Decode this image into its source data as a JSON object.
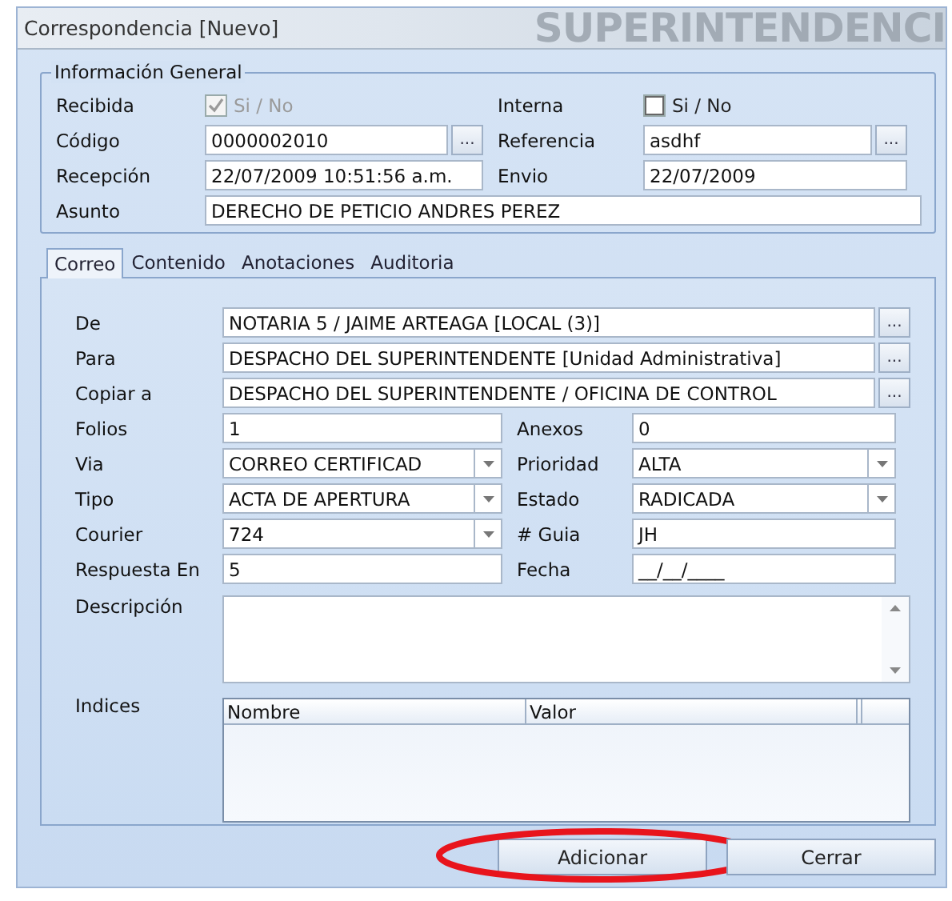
{
  "window": {
    "title": "Correspondencia [Nuevo]",
    "banner": "SUPERINTENDENCI"
  },
  "general": {
    "title": "Información General",
    "fields": [
      {
        "kind": "check",
        "label": "Recibida",
        "text": "Si / No",
        "checked": true,
        "disabled": true
      },
      {
        "kind": "check",
        "label": "Interna",
        "text": "Si / No",
        "checked": false,
        "disabled": false
      },
      {
        "kind": "lookup",
        "label": "Código",
        "value": "0000002010",
        "button": "..."
      },
      {
        "kind": "lookup",
        "label": "Referencia",
        "value": "asdhf",
        "button": "..."
      },
      {
        "kind": "text",
        "label": "Recepción",
        "value": "22/07/2009 10:51:56 a.m."
      },
      {
        "kind": "text",
        "label": "Envio",
        "value": "22/07/2009"
      },
      {
        "kind": "text",
        "label": "Asunto",
        "value": "DERECHO DE PETICIO ANDRES PEREZ",
        "wide": true
      }
    ]
  },
  "tabs": [
    {
      "label": "Correo",
      "selected": true
    },
    {
      "label": "Contenido",
      "selected": false
    },
    {
      "label": "Anotaciones",
      "selected": false
    },
    {
      "label": "Auditoria",
      "selected": false
    }
  ],
  "correo": {
    "fields": [
      {
        "kind": "lookup",
        "label": "De",
        "value": "NOTARIA 5 / JAIME ARTEAGA [LOCAL (3)]",
        "button": "...",
        "wide": true
      },
      {
        "kind": "lookup",
        "label": "Para",
        "value": "DESPACHO DEL SUPERINTENDENTE [Unidad Administrativa]",
        "button": "...",
        "wide": true
      },
      {
        "kind": "lookup",
        "label": "Copiar a",
        "value": "DESPACHO DEL SUPERINTENDENTE / OFICINA DE CONTROL",
        "button": "...",
        "wide": true
      },
      {
        "kind": "text",
        "label": "Folios",
        "value": "1"
      },
      {
        "kind": "text",
        "label": "Anexos",
        "value": "0"
      },
      {
        "kind": "combo",
        "label": "Via",
        "value": "CORREO CERTIFICAD"
      },
      {
        "kind": "combo",
        "label": "Prioridad",
        "value": "ALTA"
      },
      {
        "kind": "combo",
        "label": "Tipo",
        "value": "ACTA DE APERTURA"
      },
      {
        "kind": "combo",
        "label": "Estado",
        "value": "RADICADA"
      },
      {
        "kind": "combo",
        "label": "Courier",
        "value": "724"
      },
      {
        "kind": "text",
        "label": "# Guia",
        "value": "JH"
      },
      {
        "kind": "text",
        "label": "Respuesta En",
        "value": "5"
      },
      {
        "kind": "text",
        "label": "Fecha",
        "value": "__/__/____"
      },
      {
        "kind": "textarea",
        "label": "Descripción",
        "wide": true
      },
      {
        "kind": "table",
        "label": "Indices",
        "columns": [
          "Nombre",
          "Valor"
        ],
        "wide": true
      }
    ]
  },
  "buttons": [
    {
      "label": "Adicionar",
      "highlighted": true
    },
    {
      "label": "Cerrar",
      "highlighted": false
    }
  ]
}
